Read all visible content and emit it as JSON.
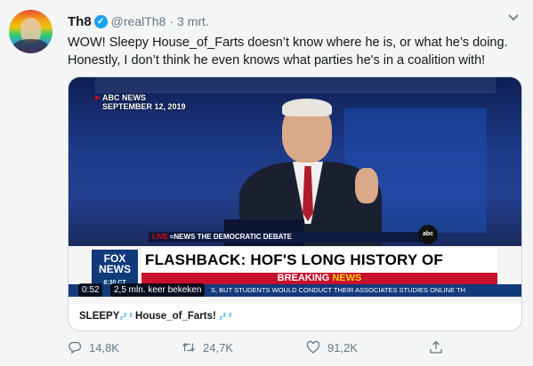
{
  "tweet": {
    "author_name": "Th8",
    "handle": "@realTh8",
    "separator": "·",
    "date": "3 mrt.",
    "text": "WOW! Sleepy House_of_Farts doesn’t know where he is, or what he’s doing. Honestly, I don’t think he even knows what parties he's in a coalition with!",
    "icons": {
      "verified": "verified-badge-icon",
      "menu": "chevron-down-icon"
    }
  },
  "video": {
    "abc_network": "ABC NEWS",
    "abc_date": "SEPTEMBER 12, 2019",
    "lower_third_live": "LIVE",
    "lower_third_text": "≈NEWS  THE DEMOCRATIC DEBATE",
    "abc_logo": "abc",
    "fox_logo": "FOX NEWS",
    "fox_time": "8:30 CT",
    "headline": "FLASHBACK:   HOF'S LONG HISTORY OF GAFFES",
    "breaking_word1": "BREAKING",
    "breaking_word2": "NEWS",
    "ticker": "S, BUT STUDENTS WOULD CONDUCT THEIR ASSOCIATES STUDIES ONLINE TH",
    "elapsed": "0:52",
    "views": "2,5 mln. keer bekeken"
  },
  "card": {
    "title_prefix": "SLEEPY",
    "title_z1": "₂ᶻ ᶻ",
    "title_middle": "House_of_Farts!",
    "title_z2": "₂ᶻ ᶻ"
  },
  "actions": {
    "reply_count": "14,8K",
    "retweet_count": "24,7K",
    "like_count": "91,2K",
    "icons": [
      "reply-icon",
      "retweet-icon",
      "like-icon",
      "share-icon"
    ]
  },
  "colors": {
    "accent": "#1da1f2",
    "muted": "#657786",
    "breaking_red": "#c8102e",
    "fox_blue": "#103a7a"
  }
}
